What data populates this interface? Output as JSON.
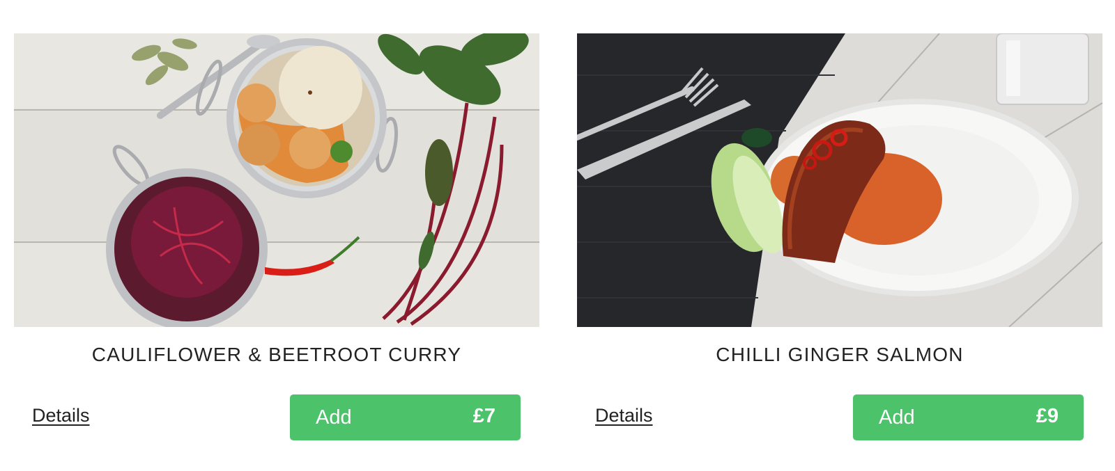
{
  "currency_symbol": "£",
  "accent_color": "#4cc36a",
  "meals": [
    {
      "title": "CAULIFLOWER & BEETROOT CURRY",
      "image_description_icon": "curry-dish-photo",
      "details_label": "Details",
      "add_label": "Add",
      "price": "£7"
    },
    {
      "title": "CHILLI GINGER SALMON",
      "image_description_icon": "salmon-dish-photo",
      "details_label": "Details",
      "add_label": "Add",
      "price": "£9"
    }
  ]
}
